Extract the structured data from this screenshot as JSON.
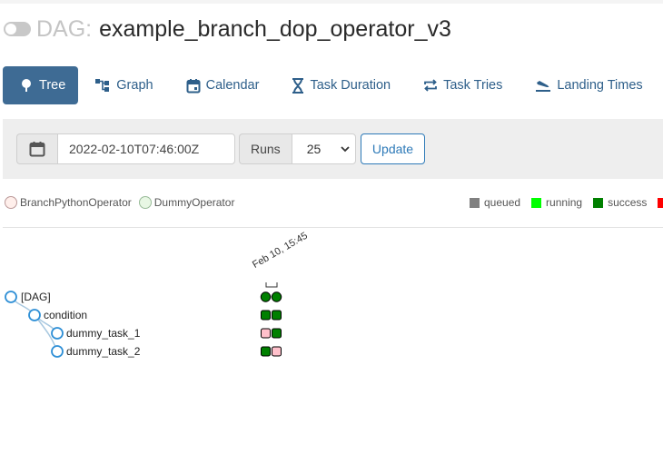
{
  "header": {
    "dag_label": "DAG:",
    "dag_id": "example_branch_dop_operator_v3"
  },
  "tabs": [
    {
      "label": "Tree",
      "icon": "tree-icon",
      "active": true
    },
    {
      "label": "Graph",
      "icon": "graph-icon"
    },
    {
      "label": "Calendar",
      "icon": "calendar-icon"
    },
    {
      "label": "Task Duration",
      "icon": "hourglass-icon"
    },
    {
      "label": "Task Tries",
      "icon": "repeat-icon"
    },
    {
      "label": "Landing Times",
      "icon": "plane-landing-icon"
    }
  ],
  "filter": {
    "base_date": "2022-02-10T07:46:00Z",
    "runs_label": "Runs",
    "runs_value": "25",
    "update_label": "Update"
  },
  "legend": {
    "operators": [
      {
        "name": "BranchPythonOperator",
        "color": "#ffefeb"
      },
      {
        "name": "DummyOperator",
        "color": "#e8f7e4"
      }
    ],
    "states": [
      {
        "name": "queued",
        "color": "#808080"
      },
      {
        "name": "running",
        "color": "#00ff00"
      },
      {
        "name": "success",
        "color": "#008000"
      },
      {
        "name": "",
        "color": "#ff0000"
      }
    ]
  },
  "tree": {
    "run_date": "Feb 10, 15:45",
    "nodes": [
      {
        "label": "[DAG]",
        "state_left": "success",
        "state_right": "success"
      },
      {
        "label": "condition",
        "state_left": "success",
        "state_right": "success"
      },
      {
        "label": "dummy_task_1",
        "state_left": "skipped",
        "state_right": "success"
      },
      {
        "label": "dummy_task_2",
        "state_left": "success",
        "state_right": "skipped"
      }
    ]
  },
  "colors": {
    "accent": "#3e6b94",
    "success": "#008000",
    "skipped": "#ffc0cb",
    "node_stroke": "#2e8fd6"
  }
}
